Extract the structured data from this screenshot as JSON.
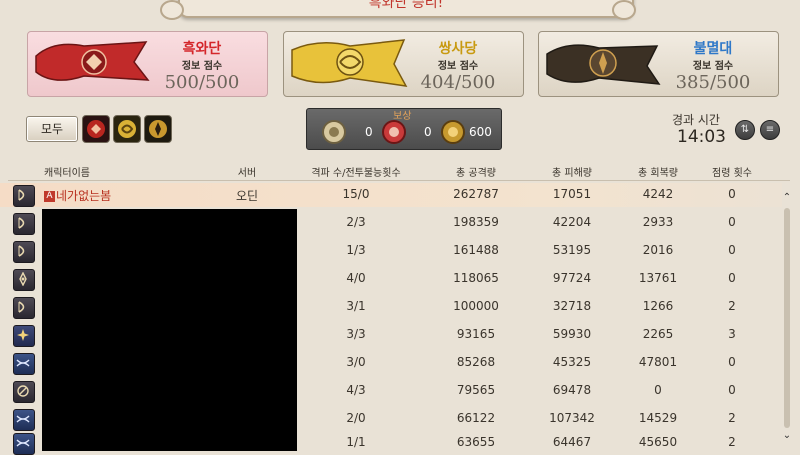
{
  "window": {
    "title": "흑와단 승리!"
  },
  "grand_companies": [
    {
      "name": "흑와단",
      "score_label": "정보 점수",
      "score": "500/500",
      "name_color": "#d4262a",
      "active": true
    },
    {
      "name": "쌍사당",
      "score_label": "정보 점수",
      "score": "404/500",
      "name_color": "#c89a10",
      "active": false
    },
    {
      "name": "불멸대",
      "score_label": "정보 점수",
      "score": "385/500",
      "name_color": "#2f78c8",
      "active": false
    }
  ],
  "filters": {
    "all_label": "모두",
    "icons": [
      "maelstrom-filter-icon",
      "twin-adder-filter-icon",
      "immortal-flames-filter-icon"
    ]
  },
  "reward": {
    "label": "보상",
    "items": [
      {
        "icon": "seal-silver-icon",
        "count": "0"
      },
      {
        "icon": "seal-red-icon",
        "count": "0"
      },
      {
        "icon": "seal-gold-icon",
        "count": "600"
      }
    ]
  },
  "elapsed": {
    "label": "경과 시간",
    "value": "14:03"
  },
  "table": {
    "headers": [
      "캐릭터이름",
      "서버",
      "격파 수/전투불능횟수",
      "총 공격량",
      "총 피해량",
      "총 회복량",
      "점령 횟수"
    ],
    "rows": [
      {
        "job": "bard-icon",
        "badge": "A",
        "name": "네가없는봄",
        "server": "오딘",
        "kd": "15/0",
        "damage": "262787",
        "taken": "17051",
        "healed": "4242",
        "captures": "0"
      },
      {
        "job": "bard-icon",
        "name": "",
        "server": "",
        "kd": "2/3",
        "damage": "198359",
        "taken": "42204",
        "healed": "2933",
        "captures": "0"
      },
      {
        "job": "bard-icon",
        "name": "",
        "server": "",
        "kd": "1/3",
        "damage": "161488",
        "taken": "53195",
        "healed": "2016",
        "captures": "0"
      },
      {
        "job": "black-mage-icon",
        "name": "",
        "server": "",
        "kd": "4/0",
        "damage": "118065",
        "taken": "97724",
        "healed": "13761",
        "captures": "0"
      },
      {
        "job": "bard-icon",
        "name": "",
        "server": "",
        "kd": "3/1",
        "damage": "100000",
        "taken": "32718",
        "healed": "1266",
        "captures": "2"
      },
      {
        "job": "astrologian-icon",
        "name": "",
        "server": "",
        "kd": "3/3",
        "damage": "93165",
        "taken": "59930",
        "healed": "2265",
        "captures": "3"
      },
      {
        "job": "dragoon-icon",
        "name": "",
        "server": "",
        "kd": "3/0",
        "damage": "85268",
        "taken": "45325",
        "healed": "47801",
        "captures": "0"
      },
      {
        "job": "monk-icon",
        "name": "",
        "server": "",
        "kd": "4/3",
        "damage": "79565",
        "taken": "69478",
        "healed": "0",
        "captures": "0"
      },
      {
        "job": "dragoon-icon",
        "name": "",
        "server": "",
        "kd": "2/0",
        "damage": "66122",
        "taken": "107342",
        "healed": "14529",
        "captures": "2"
      },
      {
        "job": "dragoon-icon",
        "name": "",
        "server": "",
        "kd": "1/1",
        "damage": "63655",
        "taken": "64467",
        "healed": "45650",
        "captures": "2"
      }
    ]
  }
}
